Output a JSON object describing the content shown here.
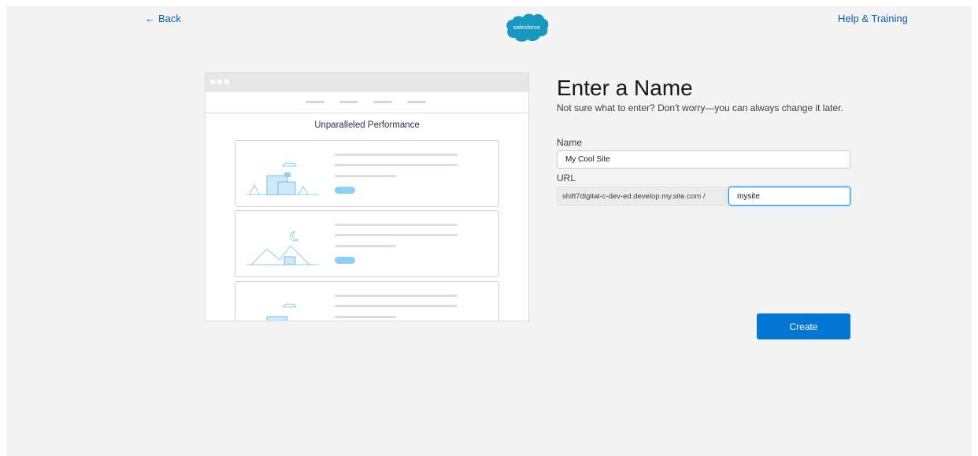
{
  "header": {
    "back_label": "Back",
    "help_label": "Help & Training",
    "logo_text": "salesforce"
  },
  "preview": {
    "title": "Unparalleled Performance"
  },
  "form": {
    "title": "Enter a Name",
    "subtitle": "Not sure what to enter? Don't worry—you can always change it later.",
    "name_label": "Name",
    "name_value": "My Cool Site",
    "url_label": "URL",
    "url_prefix": "shift7digital-c-dev-ed.develop.my.site.com /",
    "url_value": "mysite",
    "create_label": "Create"
  },
  "colors": {
    "page_bg": "#f3f3f3",
    "link": "#0b5cab",
    "brand": "#1798c1",
    "primary_button": "#0176d3",
    "illustration": "#8dcff6"
  }
}
